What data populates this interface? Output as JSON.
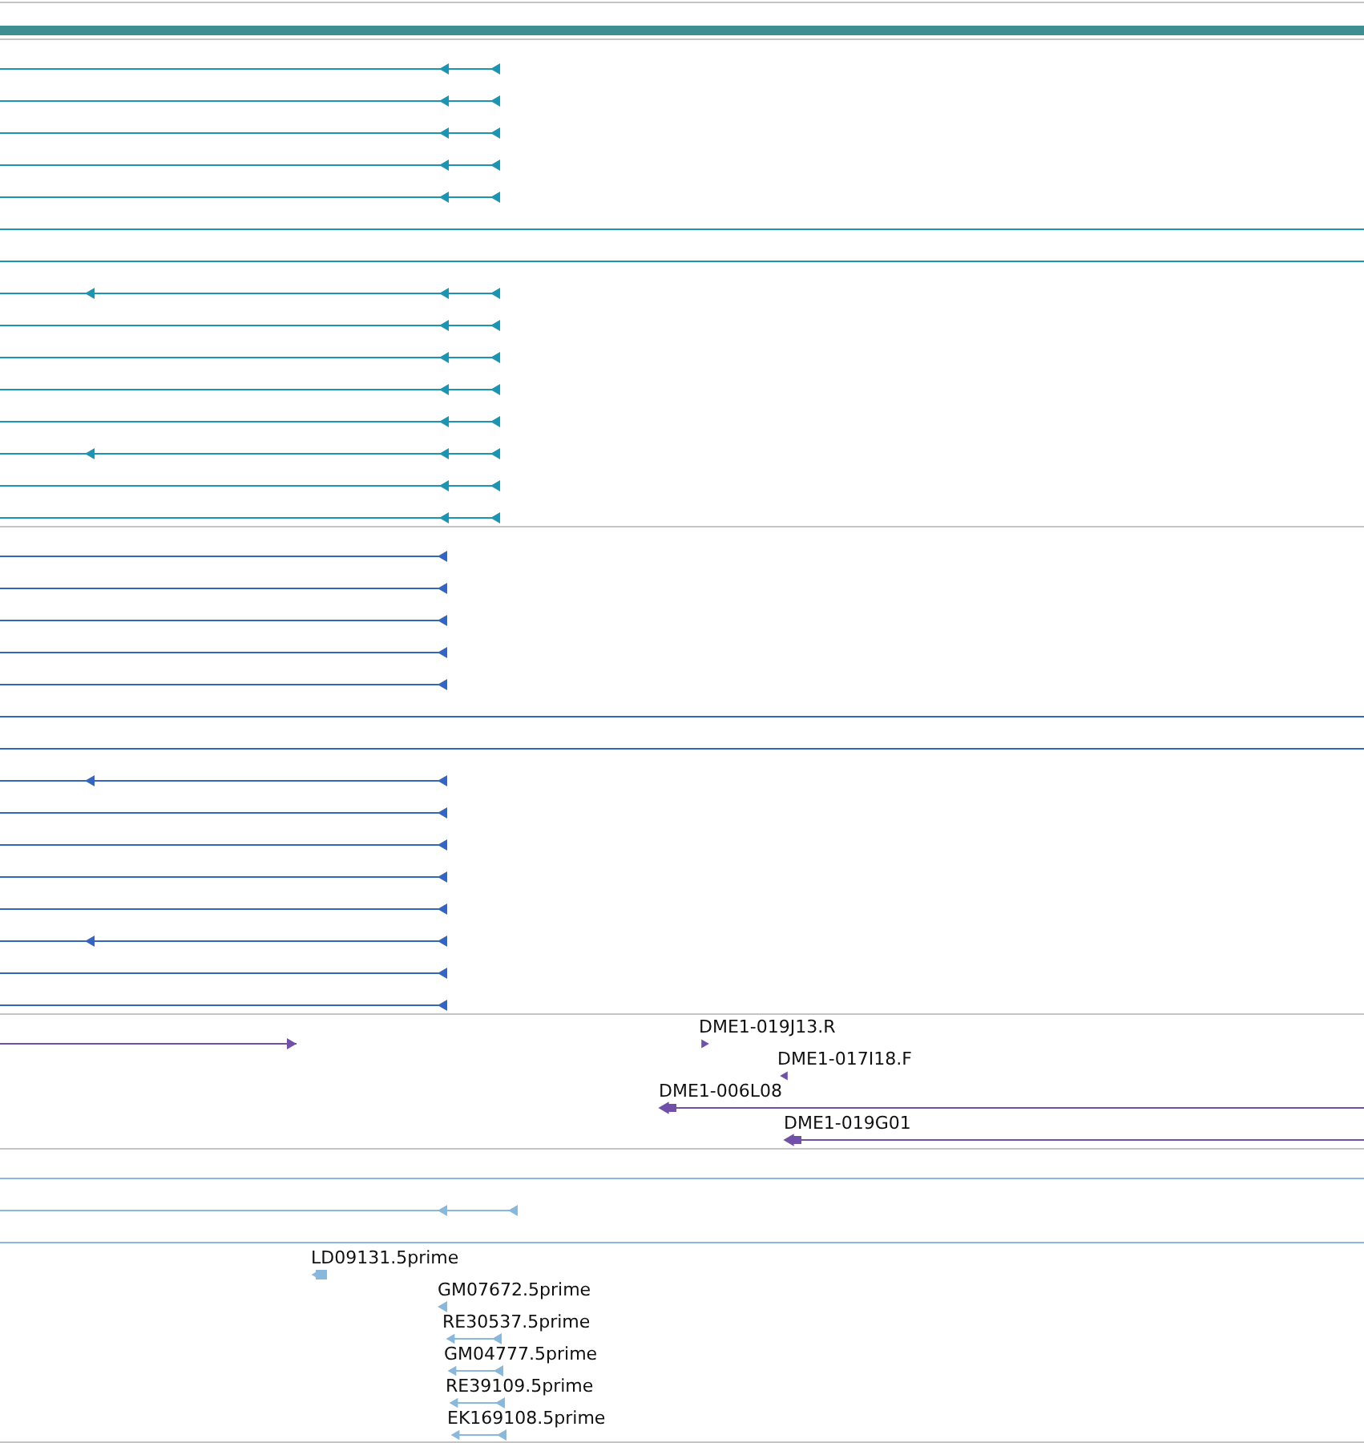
{
  "ruler": {
    "color": "#3d8f93"
  },
  "tracks": [
    {
      "color": "#1a96b4",
      "rows": [
        {
          "kind": "short"
        },
        {
          "kind": "short"
        },
        {
          "kind": "short"
        },
        {
          "kind": "short"
        },
        {
          "kind": "short"
        },
        {
          "kind": "plain"
        },
        {
          "kind": "plain"
        },
        {
          "kind": "long"
        },
        {
          "kind": "short"
        },
        {
          "kind": "short"
        },
        {
          "kind": "short"
        },
        {
          "kind": "short"
        },
        {
          "kind": "long"
        },
        {
          "kind": "short"
        },
        {
          "kind": "short"
        }
      ]
    },
    {
      "color": "#3366c4",
      "rows": [
        {
          "kind": "short"
        },
        {
          "kind": "short"
        },
        {
          "kind": "short"
        },
        {
          "kind": "short"
        },
        {
          "kind": "short"
        },
        {
          "kind": "plain"
        },
        {
          "kind": "plain"
        },
        {
          "kind": "long"
        },
        {
          "kind": "short"
        },
        {
          "kind": "short"
        },
        {
          "kind": "short"
        },
        {
          "kind": "short"
        },
        {
          "kind": "long"
        },
        {
          "kind": "short"
        },
        {
          "kind": "short"
        }
      ]
    },
    {
      "color": "#7050a8",
      "rows": [
        {
          "kind": "forward-line"
        },
        {
          "kind": "forward-tick",
          "label": "DME1-019J13.R"
        },
        {
          "kind": "reverse-tick",
          "label": "DME1-017I18.F"
        },
        {
          "kind": "reverse-line",
          "label": "DME1-006L08"
        },
        {
          "kind": "reverse-line",
          "label": "DME1-019G01"
        }
      ]
    },
    {
      "color": "#88b8dc",
      "rows": [
        {
          "kind": "plain"
        },
        {
          "kind": "short"
        },
        {
          "kind": "plain"
        }
      ]
    },
    {
      "color": "#88b8dc",
      "rows": [
        {
          "kind": "block",
          "label": "LD09131.5prime"
        },
        {
          "kind": "tick",
          "label": "GM07672.5prime"
        },
        {
          "kind": "pair",
          "label": "RE30537.5prime"
        },
        {
          "kind": "pair",
          "label": "GM04777.5prime"
        },
        {
          "kind": "pair",
          "label": "RE39109.5prime"
        },
        {
          "kind": "pair",
          "label": "EK169108.5prime"
        }
      ]
    }
  ]
}
